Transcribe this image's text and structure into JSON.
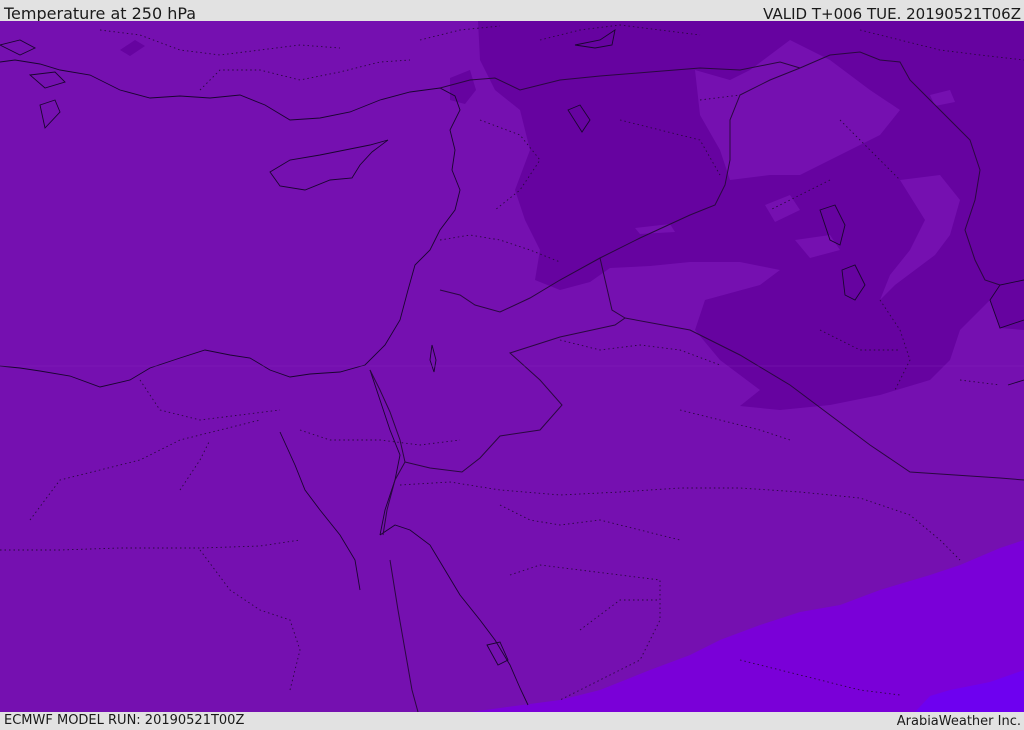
{
  "header": {
    "title": "Temperature at 250 hPa",
    "valid": "VALID T+006 TUE. 20190521T06Z"
  },
  "footer": {
    "model_run": "ECMWF MODEL RUN: 20190521T00Z",
    "credit": "ArabiaWeather Inc."
  },
  "colors": {
    "base_field": "#7510b0",
    "cold_field": "#6603a0",
    "warm_field": "#7a00d8",
    "warmest_field": "#6e00f0",
    "coastline": "#1a0530",
    "border": "#2a0840"
  }
}
